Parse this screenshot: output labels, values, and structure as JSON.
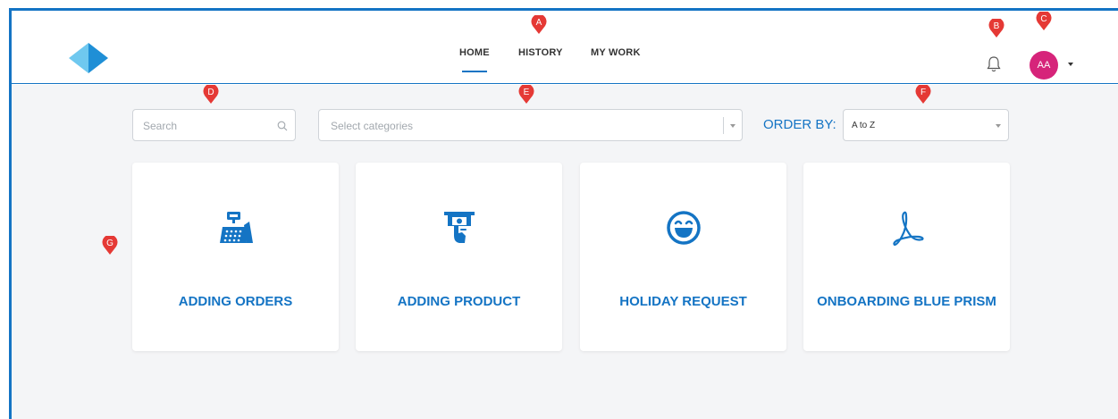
{
  "nav": {
    "home": "HOME",
    "history": "HISTORY",
    "my_work": "MY WORK"
  },
  "user": {
    "initials": "AA"
  },
  "filters": {
    "search_placeholder": "Search",
    "categories_placeholder": "Select categories",
    "order_by_label": "ORDER BY:",
    "order_by_value": "A to Z"
  },
  "cards": [
    {
      "title": "ADDING ORDERS",
      "icon": "cash-register-icon"
    },
    {
      "title": "ADDING PRODUCT",
      "icon": "atm-money-icon"
    },
    {
      "title": "HOLIDAY REQUEST",
      "icon": "smiley-icon"
    },
    {
      "title": "ONBOARDING BLUE PRISM",
      "icon": "pdf-icon"
    }
  ],
  "markers": [
    "A",
    "B",
    "C",
    "D",
    "E",
    "F",
    "G"
  ],
  "colors": {
    "accent": "#1474c4",
    "avatar": "#d6247a",
    "marker": "#e53935",
    "background": "#f4f5f7"
  }
}
